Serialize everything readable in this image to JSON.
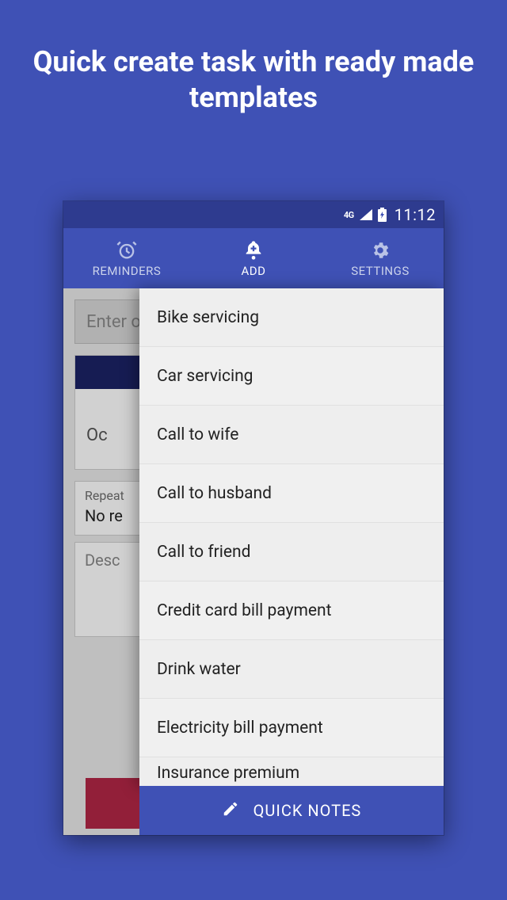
{
  "headline": "Quick create task with ready made templates",
  "statusbar": {
    "network_label": "4G",
    "clock": "11:12"
  },
  "tabs": {
    "reminders": "REMINDERS",
    "add": "ADD",
    "settings": "SETTINGS"
  },
  "form": {
    "input_placeholder": "Enter o",
    "date_partial": "Oc",
    "repeat_label": "Repeat",
    "repeat_value": "No re",
    "description_placeholder": "Desc"
  },
  "templates": [
    "Bike servicing",
    "Car servicing",
    "Call to wife",
    "Call to husband",
    "Call to friend",
    "Credit card bill payment",
    "Drink water",
    "Electricity bill payment",
    "Insurance premium"
  ],
  "quick_notes": "QUICK NOTES"
}
